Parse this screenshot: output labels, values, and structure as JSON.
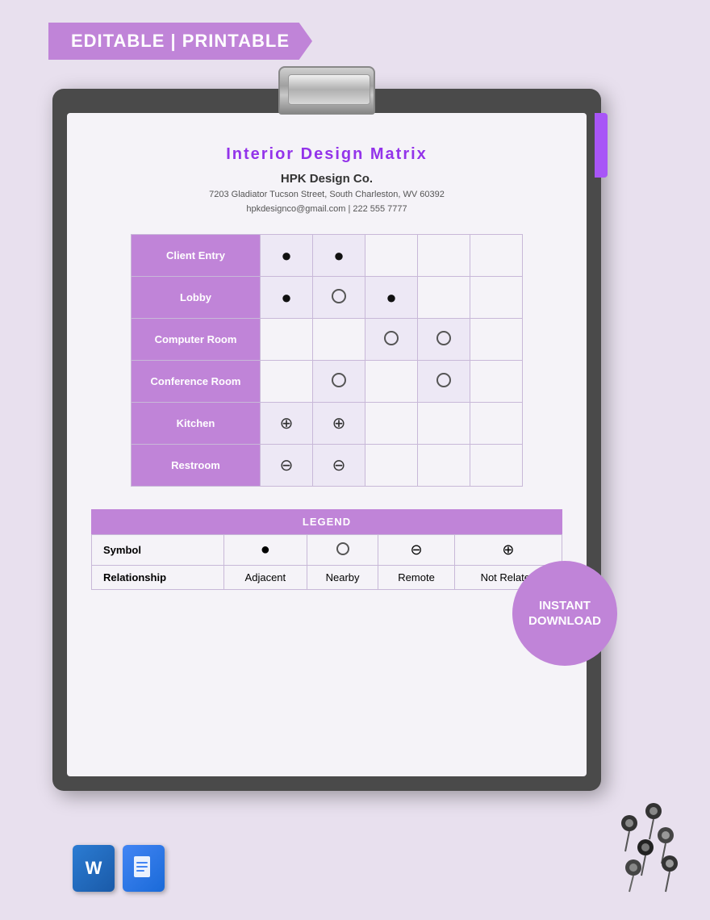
{
  "banner": {
    "text": "EDITABLE | PRINTABLE"
  },
  "document": {
    "title": "Interior Design Matrix",
    "company_name": "HPK Design Co.",
    "address_line1": "7203 Gladiator Tucson Street, South Charleston, WV 60392",
    "address_line2": "hpkdesignco@gmail.com | 222 555 7777"
  },
  "matrix": {
    "rows": [
      {
        "label": "Client Entry",
        "cells": [
          {
            "type": "filled"
          },
          {
            "type": "filled"
          },
          {
            "type": "empty"
          },
          {
            "type": "empty"
          },
          {
            "type": "empty"
          }
        ]
      },
      {
        "label": "Lobby",
        "cells": [
          {
            "type": "filled"
          },
          {
            "type": "open"
          },
          {
            "type": "filled"
          },
          {
            "type": "empty"
          },
          {
            "type": "empty"
          }
        ]
      },
      {
        "label": "Computer Room",
        "cells": [
          {
            "type": "empty"
          },
          {
            "type": "empty"
          },
          {
            "type": "open"
          },
          {
            "type": "open"
          },
          {
            "type": "empty"
          }
        ]
      },
      {
        "label": "Conference Room",
        "cells": [
          {
            "type": "empty"
          },
          {
            "type": "open"
          },
          {
            "type": "empty"
          },
          {
            "type": "open"
          },
          {
            "type": "empty"
          }
        ]
      },
      {
        "label": "Kitchen",
        "cells": [
          {
            "type": "half"
          },
          {
            "type": "half"
          },
          {
            "type": "empty"
          },
          {
            "type": "empty"
          },
          {
            "type": "empty"
          }
        ]
      },
      {
        "label": "Restroom",
        "cells": [
          {
            "type": "remote"
          },
          {
            "type": "remote"
          },
          {
            "type": "empty"
          },
          {
            "type": "empty"
          },
          {
            "type": "empty"
          }
        ]
      }
    ]
  },
  "legend": {
    "title": "LEGEND",
    "symbols": [
      "●",
      "○",
      "⊖",
      "⊕"
    ],
    "relationships": [
      "Adjacent",
      "Nearby",
      "Remote",
      "Not Related"
    ]
  },
  "instant_download": {
    "line1": "INSTANT",
    "line2": "DOWNLOAD"
  }
}
